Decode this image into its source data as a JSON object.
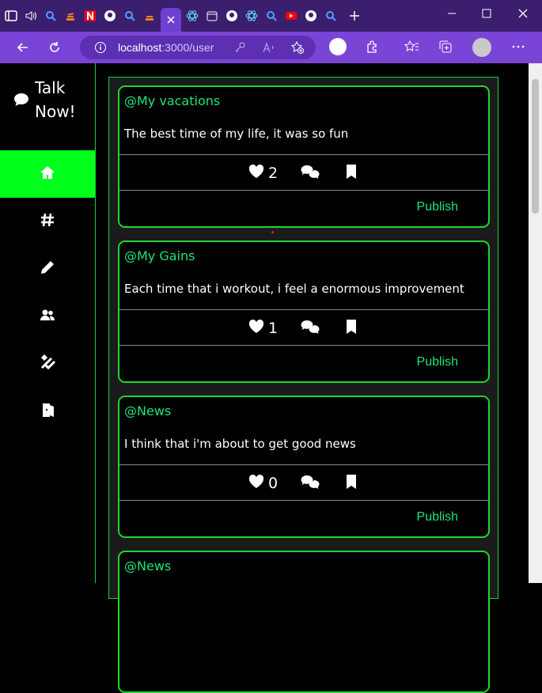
{
  "browser": {
    "url_host": "localhost",
    "url_path": ":3000/user",
    "tabs": [
      "sidebar-icon",
      "volume-icon",
      "search-icon",
      "stackoverflow-icon",
      "netflix-icon",
      "github-icon",
      "search-icon",
      "stackoverflow-icon",
      "close-icon",
      "react-icon",
      "calendar-icon",
      "github-icon",
      "react-icon",
      "search-icon",
      "youtube-icon",
      "github-icon",
      "search-icon",
      "plus-icon"
    ]
  },
  "brand": {
    "line1": "Talk",
    "line2": "Now!"
  },
  "sidebar": {
    "items": [
      {
        "name": "home",
        "icon": "home-icon",
        "active": true
      },
      {
        "name": "hashtag",
        "icon": "hashtag-icon",
        "active": false
      },
      {
        "name": "write",
        "icon": "pencil-icon",
        "active": false
      },
      {
        "name": "friends",
        "icon": "users-icon",
        "active": false
      },
      {
        "name": "settings",
        "icon": "tools-icon",
        "active": false
      },
      {
        "name": "logout",
        "icon": "door-icon",
        "active": false
      }
    ]
  },
  "posts": [
    {
      "title": "@My vacations",
      "body": "The best time of my life, it was so fun",
      "likes": "2",
      "publish": "Publish"
    },
    {
      "title": "@My Gains",
      "body": "Each time that i workout, i feel a enormous improvement",
      "likes": "1",
      "publish": "Publish"
    },
    {
      "title": "@News",
      "body": "I think that i'm about to get good news",
      "likes": "0",
      "publish": "Publish"
    },
    {
      "title": "@News",
      "body": "",
      "likes": "",
      "publish": ""
    }
  ],
  "colors": {
    "accent": "#1ed82e",
    "title": "#1de57a",
    "active": "#00ff1a",
    "browser_tab": "#3b1e6e",
    "browser_nav": "#7a45d6"
  }
}
